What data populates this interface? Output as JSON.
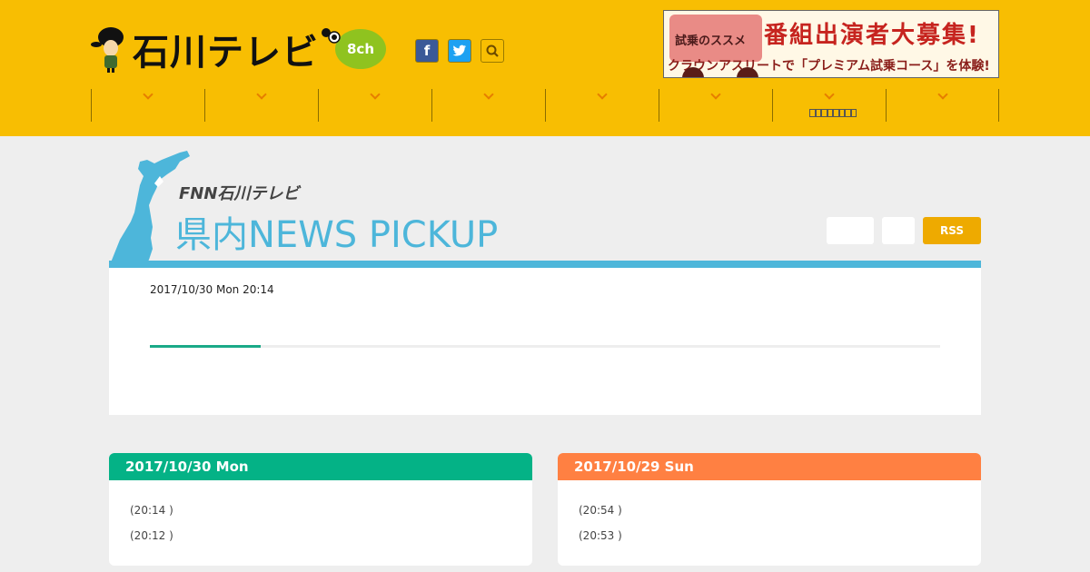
{
  "header": {
    "logo_text": "石川テレビ",
    "channel_badge": "8ch",
    "social": [
      {
        "icon": "facebook-icon",
        "glyph": "f"
      },
      {
        "icon": "twitter-icon",
        "glyph": "t"
      },
      {
        "icon": "search-icon",
        "glyph": "Q"
      }
    ],
    "banner": {
      "small_label": "試乗のススメ",
      "headline": "番組出演者大募集!",
      "subline": "クラウンアスリートで「プレミアム試乗コース」を体験!"
    },
    "nav_count": 8
  },
  "news": {
    "fnn_label": "FNN石川テレビ",
    "section_title": "県内NEWS  PICKUP",
    "rss_label": "RSS",
    "latest_timestamp": "2017/10/30 Mon 20:14",
    "slide_progress": 0.14
  },
  "days": [
    {
      "date": "2017/10/30 Mon",
      "color": "#04b286",
      "items": [
        "(20:14 )",
        "(20:12 )"
      ]
    },
    {
      "date": "2017/10/29 Sun",
      "color": "#ff8042",
      "items": [
        "(20:54 )",
        "(20:53 )"
      ]
    }
  ],
  "colors": {
    "header_bg": "#f8be02",
    "accent_blue": "#4db6da",
    "rss": "#eeaa00"
  }
}
